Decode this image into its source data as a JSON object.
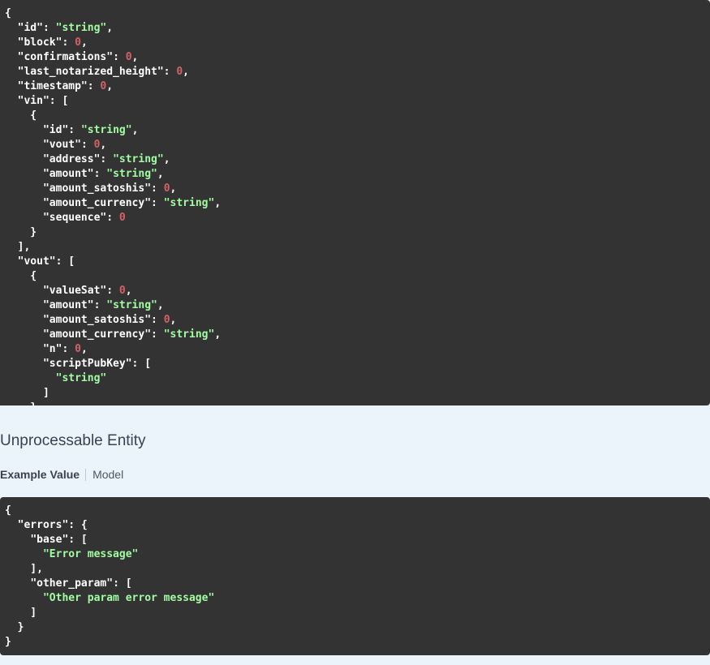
{
  "success_example": {
    "lines": [
      [
        {
          "t": "p",
          "v": "{"
        }
      ],
      [
        {
          "t": "p",
          "v": "  "
        },
        {
          "t": "k",
          "v": "\"id\""
        },
        {
          "t": "p",
          "v": ": "
        },
        {
          "t": "s",
          "v": "\"string\""
        },
        {
          "t": "p",
          "v": ","
        }
      ],
      [
        {
          "t": "p",
          "v": "  "
        },
        {
          "t": "k",
          "v": "\"block\""
        },
        {
          "t": "p",
          "v": ": "
        },
        {
          "t": "n",
          "v": "0"
        },
        {
          "t": "p",
          "v": ","
        }
      ],
      [
        {
          "t": "p",
          "v": "  "
        },
        {
          "t": "k",
          "v": "\"confirmations\""
        },
        {
          "t": "p",
          "v": ": "
        },
        {
          "t": "n",
          "v": "0"
        },
        {
          "t": "p",
          "v": ","
        }
      ],
      [
        {
          "t": "p",
          "v": "  "
        },
        {
          "t": "k",
          "v": "\"last_notarized_height\""
        },
        {
          "t": "p",
          "v": ": "
        },
        {
          "t": "n",
          "v": "0"
        },
        {
          "t": "p",
          "v": ","
        }
      ],
      [
        {
          "t": "p",
          "v": "  "
        },
        {
          "t": "k",
          "v": "\"timestamp\""
        },
        {
          "t": "p",
          "v": ": "
        },
        {
          "t": "n",
          "v": "0"
        },
        {
          "t": "p",
          "v": ","
        }
      ],
      [
        {
          "t": "p",
          "v": "  "
        },
        {
          "t": "k",
          "v": "\"vin\""
        },
        {
          "t": "p",
          "v": ": ["
        }
      ],
      [
        {
          "t": "p",
          "v": "    {"
        }
      ],
      [
        {
          "t": "p",
          "v": "      "
        },
        {
          "t": "k",
          "v": "\"id\""
        },
        {
          "t": "p",
          "v": ": "
        },
        {
          "t": "s",
          "v": "\"string\""
        },
        {
          "t": "p",
          "v": ","
        }
      ],
      [
        {
          "t": "p",
          "v": "      "
        },
        {
          "t": "k",
          "v": "\"vout\""
        },
        {
          "t": "p",
          "v": ": "
        },
        {
          "t": "n",
          "v": "0"
        },
        {
          "t": "p",
          "v": ","
        }
      ],
      [
        {
          "t": "p",
          "v": "      "
        },
        {
          "t": "k",
          "v": "\"address\""
        },
        {
          "t": "p",
          "v": ": "
        },
        {
          "t": "s",
          "v": "\"string\""
        },
        {
          "t": "p",
          "v": ","
        }
      ],
      [
        {
          "t": "p",
          "v": "      "
        },
        {
          "t": "k",
          "v": "\"amount\""
        },
        {
          "t": "p",
          "v": ": "
        },
        {
          "t": "s",
          "v": "\"string\""
        },
        {
          "t": "p",
          "v": ","
        }
      ],
      [
        {
          "t": "p",
          "v": "      "
        },
        {
          "t": "k",
          "v": "\"amount_satoshis\""
        },
        {
          "t": "p",
          "v": ": "
        },
        {
          "t": "n",
          "v": "0"
        },
        {
          "t": "p",
          "v": ","
        }
      ],
      [
        {
          "t": "p",
          "v": "      "
        },
        {
          "t": "k",
          "v": "\"amount_currency\""
        },
        {
          "t": "p",
          "v": ": "
        },
        {
          "t": "s",
          "v": "\"string\""
        },
        {
          "t": "p",
          "v": ","
        }
      ],
      [
        {
          "t": "p",
          "v": "      "
        },
        {
          "t": "k",
          "v": "\"sequence\""
        },
        {
          "t": "p",
          "v": ": "
        },
        {
          "t": "n",
          "v": "0"
        }
      ],
      [
        {
          "t": "p",
          "v": "    }"
        }
      ],
      [
        {
          "t": "p",
          "v": "  ],"
        }
      ],
      [
        {
          "t": "p",
          "v": "  "
        },
        {
          "t": "k",
          "v": "\"vout\""
        },
        {
          "t": "p",
          "v": ": ["
        }
      ],
      [
        {
          "t": "p",
          "v": "    {"
        }
      ],
      [
        {
          "t": "p",
          "v": "      "
        },
        {
          "t": "k",
          "v": "\"valueSat\""
        },
        {
          "t": "p",
          "v": ": "
        },
        {
          "t": "n",
          "v": "0"
        },
        {
          "t": "p",
          "v": ","
        }
      ],
      [
        {
          "t": "p",
          "v": "      "
        },
        {
          "t": "k",
          "v": "\"amount\""
        },
        {
          "t": "p",
          "v": ": "
        },
        {
          "t": "s",
          "v": "\"string\""
        },
        {
          "t": "p",
          "v": ","
        }
      ],
      [
        {
          "t": "p",
          "v": "      "
        },
        {
          "t": "k",
          "v": "\"amount_satoshis\""
        },
        {
          "t": "p",
          "v": ": "
        },
        {
          "t": "n",
          "v": "0"
        },
        {
          "t": "p",
          "v": ","
        }
      ],
      [
        {
          "t": "p",
          "v": "      "
        },
        {
          "t": "k",
          "v": "\"amount_currency\""
        },
        {
          "t": "p",
          "v": ": "
        },
        {
          "t": "s",
          "v": "\"string\""
        },
        {
          "t": "p",
          "v": ","
        }
      ],
      [
        {
          "t": "p",
          "v": "      "
        },
        {
          "t": "k",
          "v": "\"n\""
        },
        {
          "t": "p",
          "v": ": "
        },
        {
          "t": "n",
          "v": "0"
        },
        {
          "t": "p",
          "v": ","
        }
      ],
      [
        {
          "t": "p",
          "v": "      "
        },
        {
          "t": "k",
          "v": "\"scriptPubKey\""
        },
        {
          "t": "p",
          "v": ": ["
        }
      ],
      [
        {
          "t": "p",
          "v": "        "
        },
        {
          "t": "s",
          "v": "\"string\""
        }
      ],
      [
        {
          "t": "p",
          "v": "      ]"
        }
      ],
      [
        {
          "t": "p",
          "v": "    }"
        }
      ]
    ]
  },
  "error_response": {
    "title": "Unprocessable Entity",
    "tabs": {
      "example_value": "Example Value",
      "model": "Model"
    },
    "lines": [
      [
        {
          "t": "p",
          "v": "{"
        }
      ],
      [
        {
          "t": "p",
          "v": "  "
        },
        {
          "t": "k",
          "v": "\"errors\""
        },
        {
          "t": "p",
          "v": ": {"
        }
      ],
      [
        {
          "t": "p",
          "v": "    "
        },
        {
          "t": "k",
          "v": "\"base\""
        },
        {
          "t": "p",
          "v": ": ["
        }
      ],
      [
        {
          "t": "p",
          "v": "      "
        },
        {
          "t": "s",
          "v": "\"Error message\""
        }
      ],
      [
        {
          "t": "p",
          "v": "    ],"
        }
      ],
      [
        {
          "t": "p",
          "v": "    "
        },
        {
          "t": "k",
          "v": "\"other_param\""
        },
        {
          "t": "p",
          "v": ": ["
        }
      ],
      [
        {
          "t": "p",
          "v": "      "
        },
        {
          "t": "s",
          "v": "\"Other param error message\""
        }
      ],
      [
        {
          "t": "p",
          "v": "    ]"
        }
      ],
      [
        {
          "t": "p",
          "v": "  }"
        }
      ],
      [
        {
          "t": "p",
          "v": "}"
        }
      ]
    ]
  },
  "colors": {
    "page_bg": "#ebf3fb",
    "code_bg": "#333333",
    "string": "#a2fca2",
    "number": "#d36363",
    "key": "#ffffff",
    "title_text": "#3b4151"
  }
}
